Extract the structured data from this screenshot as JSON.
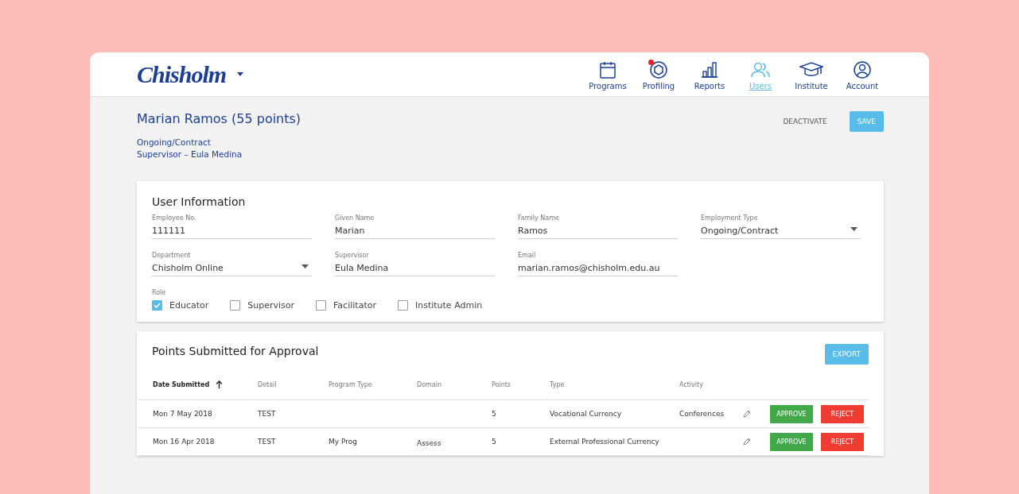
{
  "header": {
    "logo": "Chisholm",
    "nav": [
      {
        "label": "Programs",
        "kind": "calendar",
        "selected": false,
        "alert": false
      },
      {
        "label": "Profiling",
        "kind": "hexagon",
        "selected": false,
        "alert": true
      },
      {
        "label": "Reports",
        "kind": "bars",
        "selected": false,
        "alert": false
      },
      {
        "label": "Users",
        "kind": "users",
        "selected": true,
        "alert": false
      },
      {
        "label": "Institute",
        "kind": "cap",
        "selected": false,
        "alert": false
      },
      {
        "label": "Account",
        "kind": "account",
        "selected": false,
        "alert": false
      }
    ]
  },
  "profile": {
    "title": "Marian Ramos (55 points)",
    "lines": [
      "Ongoing/Contract",
      "Supervisor – Eula Medina"
    ],
    "actions": [
      "DEACTIVATE",
      "SAVE"
    ]
  },
  "user_information": {
    "title": "User Information",
    "fields": [
      {
        "label": "Employee No.",
        "value": "111111",
        "kind": "text"
      },
      {
        "label": "Given Name",
        "value": "Marian",
        "kind": "text"
      },
      {
        "label": "Family Name",
        "value": "Ramos",
        "kind": "text"
      },
      {
        "label": "Employment Type",
        "value": "Ongoing/Contract",
        "kind": "select"
      },
      {
        "label": "Department",
        "value": "Chisholm Online",
        "kind": "select"
      },
      {
        "label": "Supervisor",
        "value": "Eula Medina",
        "kind": "text"
      },
      {
        "label": "Email",
        "value": "marian.ramos@chisholm.edu.au",
        "kind": "text"
      }
    ],
    "role_label": "Role",
    "roles": [
      {
        "label": "Educator",
        "checked": true
      },
      {
        "label": "Supervisor",
        "checked": false
      },
      {
        "label": "Facilitator",
        "checked": false
      },
      {
        "label": "Institute Admin",
        "checked": false
      }
    ]
  },
  "points": {
    "title": "Points Submitted for Approval",
    "export": "EXPORT",
    "columns": [
      {
        "label": "Date Submitted",
        "sorted": true
      },
      {
        "label": "Detail",
        "sorted": false
      },
      {
        "label": "Program Type",
        "sorted": false
      },
      {
        "label": "Domain",
        "sorted": false
      },
      {
        "label": "Points",
        "sorted": false
      },
      {
        "label": "Type",
        "sorted": false
      },
      {
        "label": "Activity",
        "sorted": false
      }
    ],
    "rows": [
      {
        "cells": [
          "Mon 7 May 2018",
          "TEST",
          "",
          "",
          "5",
          "Vocational Currency",
          "Conferences"
        ],
        "approve": "APPROVE",
        "reject": "REJECT"
      },
      {
        "cells": [
          "Mon 16 Apr 2018",
          "TEST",
          "My Prog",
          "Assess",
          "5",
          "External Professional Currency",
          ""
        ],
        "approve": "APPROVE",
        "reject": "REJECT"
      }
    ]
  }
}
